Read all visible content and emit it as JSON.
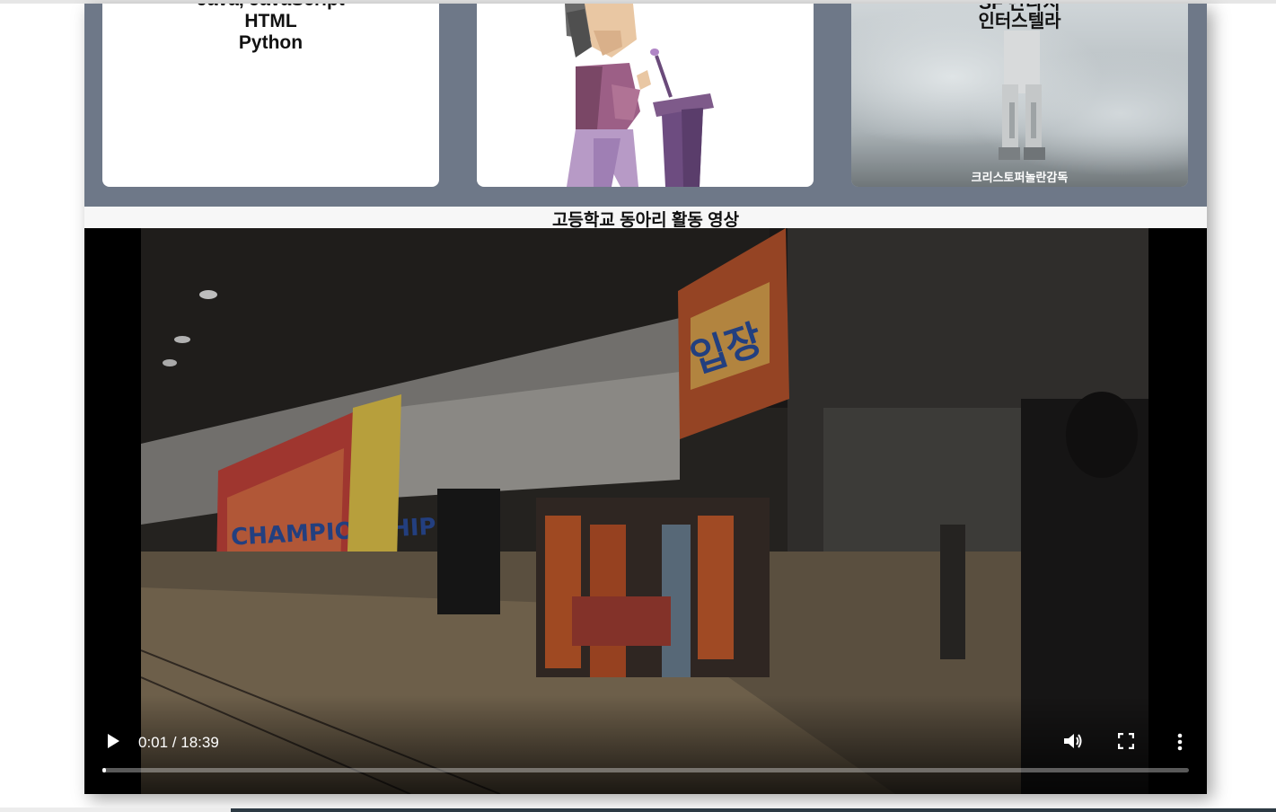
{
  "cards": [
    {
      "lines": [
        "Java, JavaScript",
        "HTML",
        "Python"
      ]
    },
    {
      "image": "speaker-at-podium-illustration"
    },
    {
      "lines": [
        "SF 판타지",
        "인터스텔라"
      ],
      "credit": "크리스토퍼놀란감독",
      "image": "astronaut-in-snow-poster"
    }
  ],
  "video": {
    "title": "고등학교 동아리 활동 영상",
    "time": "0:01 / 18:39",
    "progress": 0.001,
    "controls": [
      "play-icon",
      "volume-icon",
      "fullscreen-icon",
      "more-icon"
    ]
  },
  "colors": {
    "band": "#6e7888",
    "page": "#f7f7f7"
  }
}
